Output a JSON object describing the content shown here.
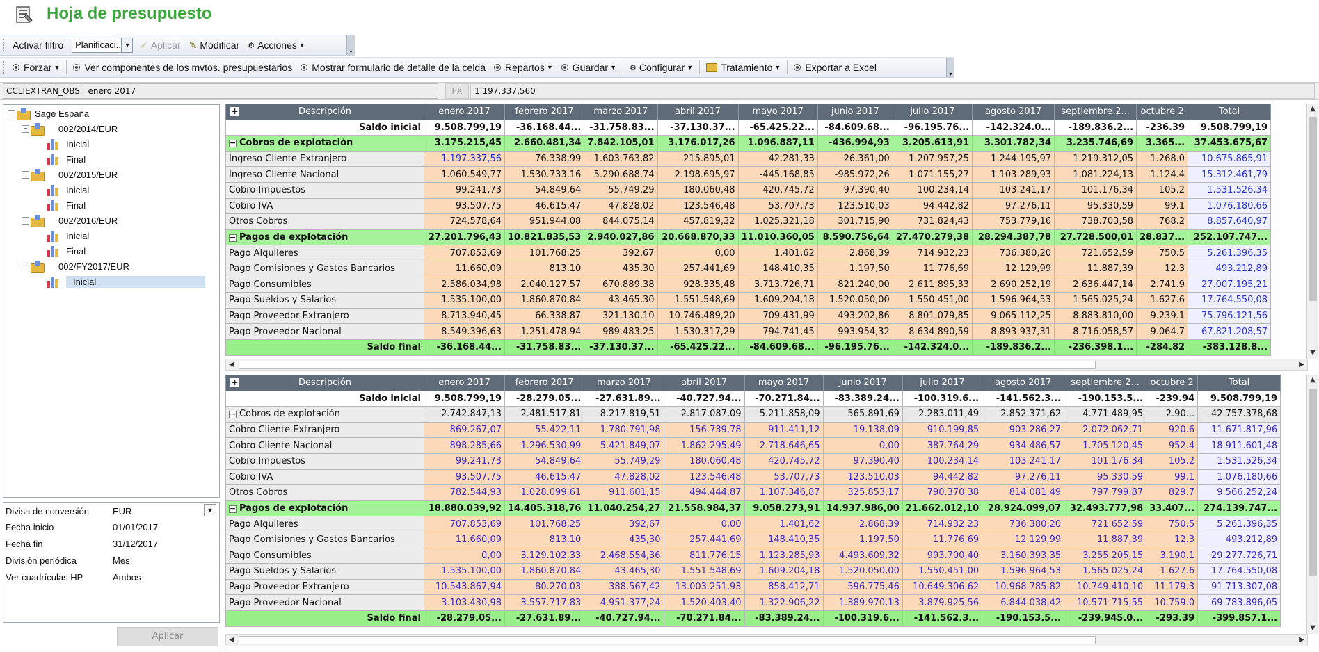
{
  "app": {
    "title": "Hoja de presupuesto"
  },
  "toolbar1": {
    "filter_label": "Activar filtro",
    "filter_value": "Planificaci...",
    "apply": "Aplicar",
    "modify": "Modificar",
    "actions": "Acciones"
  },
  "toolbar2": {
    "items": [
      "Forzar",
      "Ver componentes de los mvtos. presupuestarios",
      "Mostrar formulario de detalle de la celda",
      "Repartos",
      "Guardar",
      "Configurar",
      "Tratamiento",
      "Exportar a Excel"
    ]
  },
  "cellbar": {
    "ref": "CCLIEXTRAN_OBS   enero 2017",
    "fx": "FX",
    "value": "1.197.337,560"
  },
  "tree": {
    "root": "Sage España",
    "groups": [
      {
        "label": "002/2014/EUR",
        "children": [
          "Inicial",
          "Final"
        ]
      },
      {
        "label": "002/2015/EUR",
        "children": [
          "Inicial",
          "Final"
        ]
      },
      {
        "label": "002/2016/EUR",
        "children": [
          "Inicial",
          "Final"
        ]
      },
      {
        "label": "002/FY2017/EUR",
        "children": [
          "Inicial"
        ]
      }
    ]
  },
  "props": {
    "rows": [
      {
        "k": "Divisa de conversión",
        "v": "EUR"
      },
      {
        "k": "Fecha inicio",
        "v": "01/01/2017"
      },
      {
        "k": "Fecha fin",
        "v": "31/12/2017"
      },
      {
        "k": "División periódica",
        "v": "Mes"
      },
      {
        "k": "Ver cuadrículas HP",
        "v": "Ambos"
      }
    ],
    "apply": "Aplicar"
  },
  "columns": [
    "Descripción",
    "enero 2017",
    "febrero 2017",
    "marzo 2017",
    "abril 2017",
    "mayo 2017",
    "junio 2017",
    "julio 2017",
    "agosto 2017",
    "septiembre 2...",
    "octubre 2",
    "Total"
  ],
  "grid1": {
    "saldo_inicial": {
      "label": "Saldo inicial",
      "values": [
        "9.508.799,19",
        "-36.168.44...",
        "-31.758.83...",
        "-37.130.37...",
        "-65.425.22...",
        "-84.609.68...",
        "-96.195.76...",
        "-142.324.0...",
        "-189.836.2...",
        "-236.39",
        "9.508.799,19"
      ]
    },
    "cobros": {
      "label": "Cobros de explotación",
      "values": [
        "3.175.215,45",
        "2.660.481,34",
        "7.842.105,01",
        "3.176.017,26",
        "1.096.887,11",
        "-436.994,93",
        "3.205.613,91",
        "3.301.782,34",
        "3.235.746,69",
        "3.365...",
        "37.453.675,67"
      ]
    },
    "cobros_rows": [
      {
        "label": "Ingreso Cliente Extranjero",
        "values": [
          "1.197.337,56",
          "76.338,99",
          "1.603.763,82",
          "215.895,01",
          "42.281,33",
          "26.361,00",
          "1.207.957,25",
          "1.244.195,97",
          "1.219.312,05",
          "1.268.0",
          "10.675.865,91"
        ]
      },
      {
        "label": "Ingreso Cliente Nacional",
        "values": [
          "1.060.549,77",
          "1.530.733,16",
          "5.290.688,74",
          "2.198.695,97",
          "-445.168,85",
          "-985.972,26",
          "1.071.155,27",
          "1.103.289,93",
          "1.081.224,13",
          "1.124.4",
          "15.312.461,79"
        ]
      },
      {
        "label": "Cobro Impuestos",
        "values": [
          "99.241,73",
          "54.849,64",
          "55.749,29",
          "180.060,48",
          "420.745,72",
          "97.390,40",
          "100.234,14",
          "103.241,17",
          "101.176,34",
          "105.2",
          "1.531.526,34"
        ]
      },
      {
        "label": "Cobro IVA",
        "values": [
          "93.507,75",
          "46.615,47",
          "47.828,02",
          "123.546,48",
          "53.707,73",
          "123.510,03",
          "94.442,82",
          "97.276,11",
          "95.330,59",
          "99.1",
          "1.076.180,66"
        ]
      },
      {
        "label": "Otros Cobros",
        "values": [
          "724.578,64",
          "951.944,08",
          "844.075,14",
          "457.819,32",
          "1.025.321,18",
          "301.715,90",
          "731.824,43",
          "753.779,16",
          "738.703,58",
          "768.2",
          "8.857.640,97"
        ]
      }
    ],
    "pagos": {
      "label": "Pagos de explotación",
      "values": [
        "27.201.796,43",
        "10.821.835,53",
        "2.940.027,86",
        "20.668.870,33",
        "11.010.360,05",
        "8.590.756,64",
        "27.470.279,38",
        "28.294.387,78",
        "27.728.500,01",
        "28.837...",
        "252.107.747..."
      ]
    },
    "pagos_rows": [
      {
        "label": "Pago Alquileres",
        "values": [
          "707.853,69",
          "101.768,25",
          "392,67",
          "0,00",
          "1.401,62",
          "2.868,39",
          "714.932,23",
          "736.380,20",
          "721.652,59",
          "750.5",
          "5.261.396,35"
        ]
      },
      {
        "label": "Pago Comisiones y Gastos Bancarios",
        "values": [
          "11.660,09",
          "813,10",
          "435,30",
          "257.441,69",
          "148.410,35",
          "1.197,50",
          "11.776,69",
          "12.129,99",
          "11.887,39",
          "12.3",
          "493.212,89"
        ]
      },
      {
        "label": "Pago Consumibles",
        "values": [
          "2.586.034,98",
          "2.040.127,57",
          "670.889,38",
          "928.335,48",
          "3.713.726,71",
          "821.240,00",
          "2.611.895,33",
          "2.690.252,19",
          "2.636.447,14",
          "2.741.9",
          "27.007.195,21"
        ]
      },
      {
        "label": "Pago Sueldos y Salarios",
        "values": [
          "1.535.100,00",
          "1.860.870,84",
          "43.465,30",
          "1.551.548,69",
          "1.609.204,18",
          "1.520.050,00",
          "1.550.451,00",
          "1.596.964,53",
          "1.565.025,24",
          "1.627.6",
          "17.764.550,08"
        ]
      },
      {
        "label": "Pago Proveedor Extranjero",
        "values": [
          "8.713.940,45",
          "66.338,87",
          "321.130,10",
          "10.746.489,20",
          "709.431,99",
          "493.202,86",
          "8.801.079,85",
          "9.065.112,25",
          "8.883.810,00",
          "9.239.1",
          "75.796.121,56"
        ]
      },
      {
        "label": "Pago Proveedor Nacional",
        "values": [
          "8.549.396,63",
          "1.251.478,94",
          "989.483,25",
          "1.530.317,29",
          "794.741,45",
          "993.954,32",
          "8.634.890,59",
          "8.893.937,31",
          "8.716.058,57",
          "9.064.7",
          "67.821.208,57"
        ]
      }
    ],
    "saldo_final": {
      "label": "Saldo final",
      "values": [
        "-36.168.44...",
        "-31.758.83...",
        "-37.130.37...",
        "-65.425.22...",
        "-84.609.68...",
        "-96.195.76...",
        "-142.324.0...",
        "-189.836.2...",
        "-236.398.1...",
        "-284.82",
        "-383.128.8..."
      ]
    }
  },
  "grid2": {
    "saldo_inicial": {
      "label": "Saldo inicial",
      "values": [
        "9.508.799,19",
        "-28.279.05...",
        "-27.631.89...",
        "-40.727.94...",
        "-70.271.84...",
        "-83.389.24...",
        "-100.319.6...",
        "-141.562.3...",
        "-190.153.5...",
        "-239.94",
        "9.508.799,19"
      ]
    },
    "cobros": {
      "label": "Cobros de explotación",
      "values": [
        "2.742.847,13",
        "2.481.517,81",
        "8.217.819,51",
        "2.817.087,09",
        "5.211.858,09",
        "565.891,69",
        "2.283.011,49",
        "2.852.371,62",
        "4.771.489,95",
        "2.90...",
        "42.757.378,68"
      ]
    },
    "cobros_rows": [
      {
        "label": "Cobro Cliente Extranjero",
        "values": [
          "869.267,07",
          "55.422,11",
          "1.780.791,98",
          "156.739,78",
          "911.411,12",
          "19.138,09",
          "910.199,85",
          "903.286,27",
          "2.072.062,71",
          "920.6",
          "11.671.817,96"
        ]
      },
      {
        "label": "Cobro Cliente Nacional",
        "values": [
          "898.285,66",
          "1.296.530,99",
          "5.421.849,07",
          "1.862.295,49",
          "2.718.646,65",
          "0,00",
          "387.764,29",
          "934.486,57",
          "1.705.120,45",
          "952.4",
          "18.911.601,48"
        ]
      },
      {
        "label": "Cobro Impuestos",
        "values": [
          "99.241,73",
          "54.849,64",
          "55.749,29",
          "180.060,48",
          "420.745,72",
          "97.390,40",
          "100.234,14",
          "103.241,17",
          "101.176,34",
          "105.2",
          "1.531.526,34"
        ]
      },
      {
        "label": "Cobro IVA",
        "values": [
          "93.507,75",
          "46.615,47",
          "47.828,02",
          "123.546,48",
          "53.707,73",
          "123.510,03",
          "94.442,82",
          "97.276,11",
          "95.330,59",
          "99.1",
          "1.076.180,66"
        ]
      },
      {
        "label": "Otros Cobros",
        "values": [
          "782.544,93",
          "1.028.099,61",
          "911.601,15",
          "494.444,87",
          "1.107.346,87",
          "325.853,17",
          "790.370,38",
          "814.081,49",
          "797.799,87",
          "829.7",
          "9.566.252,24"
        ]
      }
    ],
    "pagos": {
      "label": "Pagos de explotación",
      "values": [
        "18.880.039,92",
        "14.405.318,76",
        "11.040.254,27",
        "21.558.984,37",
        "9.058.273,91",
        "14.937.986,00",
        "21.662.012,10",
        "28.924.099,07",
        "32.493.777,98",
        "33.407...",
        "274.139.747..."
      ]
    },
    "pagos_rows": [
      {
        "label": "Pago Alquileres",
        "values": [
          "707.853,69",
          "101.768,25",
          "392,67",
          "0,00",
          "1.401,62",
          "2.868,39",
          "714.932,23",
          "736.380,20",
          "721.652,59",
          "750.5",
          "5.261.396,35"
        ]
      },
      {
        "label": "Pago Comisiones y Gastos Bancarios",
        "values": [
          "11.660,09",
          "813,10",
          "435,30",
          "257.441,69",
          "148.410,35",
          "1.197,50",
          "11.776,69",
          "12.129,99",
          "11.887,39",
          "12.3",
          "493.212,89"
        ]
      },
      {
        "label": "Pago Consumibles",
        "values": [
          "0,00",
          "3.129.102,33",
          "2.468.554,36",
          "811.776,15",
          "1.123.285,93",
          "4.493.609,32",
          "993.700,40",
          "3.160.393,35",
          "3.255.205,15",
          "3.190.1",
          "29.277.726,71"
        ]
      },
      {
        "label": "Pago Sueldos y Salarios",
        "values": [
          "1.535.100,00",
          "1.860.870,84",
          "43.465,30",
          "1.551.548,69",
          "1.609.204,18",
          "1.520.050,00",
          "1.550.451,00",
          "1.596.964,53",
          "1.565.025,24",
          "1.627.6",
          "17.764.550,08"
        ]
      },
      {
        "label": "Pago Proveedor Extranjero",
        "values": [
          "10.543.867,94",
          "80.270,03",
          "388.567,42",
          "13.003.251,93",
          "858.412,71",
          "596.775,46",
          "10.649.306,62",
          "10.968.785,82",
          "10.749.410,10",
          "11.179.3",
          "91.713.307,08"
        ]
      },
      {
        "label": "Pago Proveedor Nacional",
        "values": [
          "3.103.430,98",
          "3.557.717,83",
          "4.951.377,24",
          "1.520.403,40",
          "1.322.906,22",
          "1.389.970,13",
          "3.879.925,56",
          "6.844.038,42",
          "10.571.715,55",
          "10.759.0",
          "69.783.896,05"
        ]
      }
    ],
    "saldo_final": {
      "label": "Saldo final",
      "values": [
        "-28.279.05...",
        "-27.631.89...",
        "-40.727.94...",
        "-70.271.84...",
        "-83.389.24...",
        "-100.319.6...",
        "-141.562.3...",
        "-190.153.5...",
        "-239.945.0...",
        "-293.39",
        "-399.857.1..."
      ]
    }
  },
  "colors": {
    "title_green": "#3aa83a",
    "group_green": "#a6f29a",
    "cell_orange": "#fbd9b9",
    "value_blue": "#3133d6"
  }
}
